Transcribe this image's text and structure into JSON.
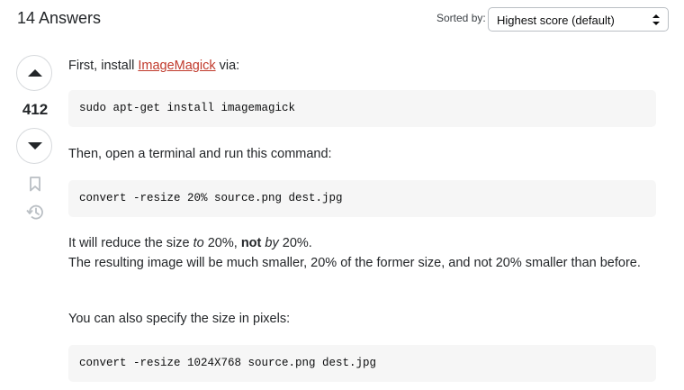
{
  "header": {
    "answers_count": "14 Answers",
    "sort_label": "Sorted by:",
    "sort_value": "Highest score (default)"
  },
  "answer": {
    "score": "412",
    "paragraph1_prefix": "First, install ",
    "paragraph1_link": "ImageMagick",
    "paragraph1_suffix": " via:",
    "code1": "sudo apt-get install imagemagick",
    "paragraph2": "Then, open a terminal and run this command:",
    "code2": "convert -resize 20% source.png dest.jpg",
    "paragraph3_part1": "It will reduce the size ",
    "paragraph3_em1": "to",
    "paragraph3_part2": " 20%, ",
    "paragraph3_strong": "not",
    "paragraph3_part3": " ",
    "paragraph3_em2": "by",
    "paragraph3_part4": " 20%.",
    "paragraph3_line2": "The resulting image will be much smaller, 20% of the former size, and not 20% smaller than before.",
    "paragraph4": "You can also specify the size in pixels:",
    "code3": "convert -resize 1024X768 source.png dest.jpg"
  },
  "colors": {
    "link": "#c0392b",
    "code_background": "#f6f6f6",
    "icon": "#babfc4"
  },
  "icons": {
    "upvote": "upvote-arrow-icon",
    "downvote": "downvote-arrow-icon",
    "bookmark": "bookmark-icon",
    "history": "history-icon",
    "select_arrows": "chevron-up-down-icon"
  }
}
